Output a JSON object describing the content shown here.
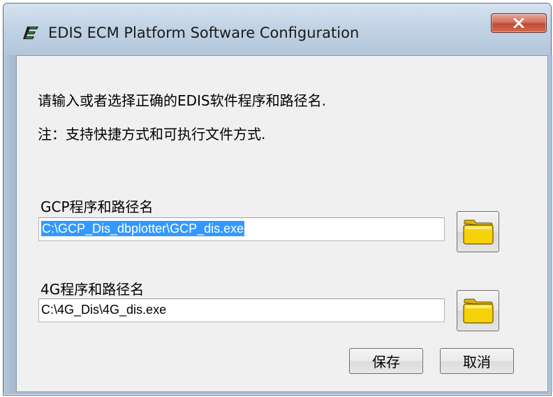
{
  "window": {
    "title": "EDIS ECM Platform Software Configuration",
    "close_glyph": "X"
  },
  "instructions": {
    "line1": "请输入或者选择正确的EDIS软件程序和路径名.",
    "line2": "注：支持快捷方式和可执行文件方式."
  },
  "gcp": {
    "label": "GCP程序和路径名",
    "value": "C:\\GCP_Dis_dbplotter\\GCP_dis.exe",
    "browse_icon": "folder-icon"
  },
  "g4": {
    "label": "4G程序和路径名",
    "value": "C:\\4G_Dis\\4G_dis.exe",
    "browse_icon": "folder-icon"
  },
  "buttons": {
    "save": "保存",
    "cancel": "取消"
  },
  "colors": {
    "selection": "#3399ff",
    "client_bg": "#f0f0f0",
    "close_red": "#c24c35",
    "folder_yellow": "#f5d20a"
  }
}
